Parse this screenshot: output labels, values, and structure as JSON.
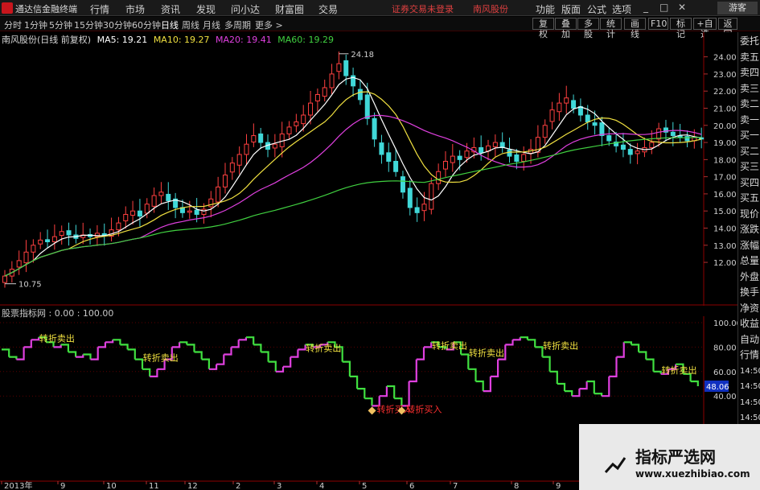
{
  "app": {
    "title": "通达信金融终端",
    "menu": [
      "行情",
      "市场",
      "资讯",
      "发现",
      "问小达",
      "财富圈",
      "交易"
    ],
    "status_notice": "证券交易未登录",
    "status_stock": "南风股份",
    "right_menu": [
      "功能",
      "版面",
      "公式",
      "选项"
    ],
    "window_controls": [
      "_",
      "□",
      "✕"
    ],
    "guest_label": "游客"
  },
  "toolbar": {
    "periods": [
      "分时",
      "1分钟",
      "5分钟",
      "15分钟",
      "30分钟",
      "60分钟",
      "日线",
      "周线",
      "月线",
      "多周期",
      "更多 >"
    ],
    "active_period": "日线",
    "right_buttons": [
      "复权",
      "叠加",
      "多股",
      "统计",
      "画线",
      "F10",
      "标记",
      "+自选",
      "返回"
    ]
  },
  "main_header": {
    "stock_label": "南风股份(日线 前复权)",
    "ma_items": [
      {
        "text": "MA5: 19.21",
        "color": "#ffffff"
      },
      {
        "text": "MA10: 19.27",
        "color": "#f0e040"
      },
      {
        "text": "MA20: 19.41",
        "color": "#e040e0"
      },
      {
        "text": "MA60: 19.29",
        "color": "#40d040"
      }
    ]
  },
  "right_panel": {
    "items": [
      "委托",
      "卖五",
      "卖四",
      "卖三",
      "卖二",
      "卖一",
      "买一",
      "买二",
      "买三",
      "买四",
      "买五",
      "现价",
      "涨跌",
      "涨幅",
      "总量",
      "外盘",
      "换手",
      "净资",
      "收益",
      "自动",
      "行情",
      "14:50",
      "14:50",
      "14:50",
      "14:50",
      "14:50",
      "14:50",
      "14:50"
    ]
  },
  "sub_header": {
    "label": "股票指标网 : 0.00 : 100.00"
  },
  "chart_data": [
    {
      "type": "candlestick",
      "title": "南风股份(日线 前复权)",
      "ylim": [
        10.5,
        24.5
      ],
      "yticks": [
        12.0,
        13.0,
        14.0,
        15.0,
        16.0,
        17.0,
        18.0,
        19.0,
        20.0,
        21.0,
        22.0,
        23.0,
        24.0
      ],
      "high_label": "24.18",
      "low_label": "10.75",
      "x_labels": [
        "2013年",
        "9",
        "10",
        "11",
        "12",
        "2",
        "3",
        "4",
        "5",
        "6",
        "7",
        "8",
        "9"
      ],
      "closes": [
        11.2,
        11.6,
        12.1,
        12.6,
        13.0,
        13.3,
        13.2,
        13.5,
        13.8,
        13.6,
        13.4,
        13.6,
        13.5,
        13.7,
        13.6,
        13.9,
        14.3,
        14.8,
        15.0,
        14.7,
        15.4,
        15.9,
        16.1,
        15.6,
        15.2,
        14.9,
        15.0,
        14.8,
        15.1,
        15.7,
        16.4,
        17.1,
        17.8,
        18.3,
        18.9,
        19.4,
        19.0,
        18.6,
        18.9,
        19.5,
        19.9,
        20.2,
        20.6,
        21.3,
        21.8,
        22.2,
        23.0,
        23.6,
        22.9,
        22.3,
        21.5,
        20.4,
        19.2,
        18.3,
        17.9,
        17.3,
        16.1,
        15.2,
        14.9,
        15.4,
        16.6,
        17.3,
        17.9,
        18.2,
        18.0,
        18.5,
        18.7,
        18.4,
        18.8,
        19.0,
        18.7,
        18.2,
        17.9,
        18.3,
        18.6,
        19.3,
        20.0,
        20.9,
        21.3,
        21.6,
        21.0,
        20.6,
        20.2,
        20.0,
        19.4,
        19.1,
        18.8,
        18.6,
        18.3,
        18.5,
        18.7,
        19.0,
        19.8,
        19.6,
        19.4,
        19.3,
        19.1,
        19.3,
        19.2
      ],
      "series": [
        {
          "name": "MA5",
          "value": 19.21,
          "color": "#ffffff"
        },
        {
          "name": "MA10",
          "value": 19.27,
          "color": "#f0e040"
        },
        {
          "name": "MA20",
          "value": 19.41,
          "color": "#e040e0"
        },
        {
          "name": "MA60",
          "value": 19.29,
          "color": "#40d040"
        }
      ]
    },
    {
      "type": "line",
      "title": "股票指标网",
      "ylim": [
        0,
        100
      ],
      "yticks": [
        40.0,
        60.0,
        80.0,
        100.0
      ],
      "current_value": "48.06",
      "annotations": [
        "转折卖出",
        "转折卖出",
        "转折卖出",
        "转折卖出",
        "转折卖出",
        "转折卖出",
        "转折卖出",
        "转折买入",
        "转折买入"
      ],
      "values": [
        78,
        72,
        70,
        80,
        86,
        88,
        84,
        80,
        82,
        76,
        72,
        74,
        70,
        80,
        84,
        86,
        82,
        78,
        70,
        62,
        56,
        62,
        70,
        80,
        84,
        82,
        76,
        70,
        62,
        66,
        74,
        80,
        86,
        88,
        82,
        76,
        68,
        60,
        64,
        72,
        78,
        82,
        80,
        82,
        84,
        80,
        68,
        56,
        46,
        38,
        32,
        40,
        48,
        38,
        32,
        52,
        70,
        80,
        84,
        80,
        78,
        84,
        74,
        62,
        52,
        44,
        56,
        70,
        82,
        86,
        88,
        86,
        80,
        72,
        60,
        50,
        44,
        40,
        46,
        52,
        42,
        40,
        56,
        72,
        84,
        82,
        76,
        70,
        60,
        58,
        62,
        66,
        58,
        52,
        48
      ]
    }
  ],
  "watermark": {
    "site_name": "指标严选网",
    "site_url": "www.xuezhibiao.com"
  }
}
